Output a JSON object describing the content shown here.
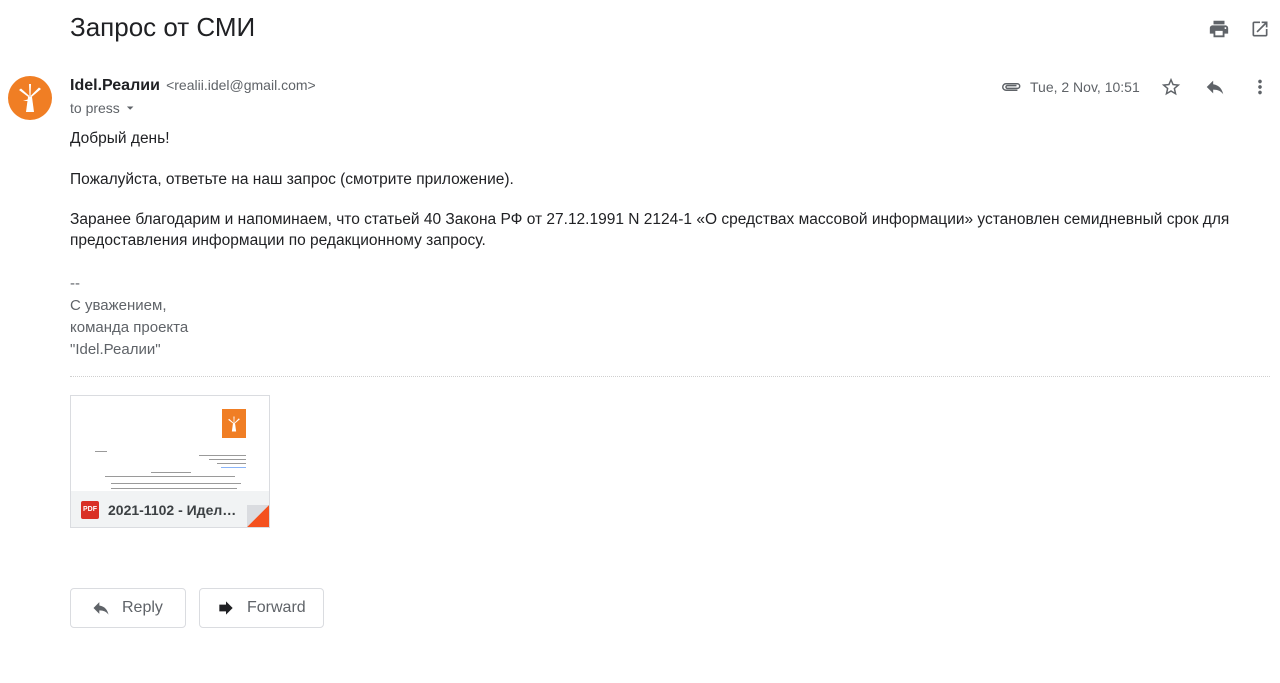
{
  "email": {
    "subject": "Запрос от СМИ",
    "sender_name": "Idel.Реалии",
    "sender_email": "<realii.idel@gmail.com>",
    "recipient": "to press",
    "date": "Tue, 2 Nov, 10:51",
    "greeting": "Добрый день!",
    "request": "Пожалуйста, ответьте на наш запрос (смотрите приложение).",
    "note": "Заранее благодарим и напоминаем, что статьей 40 Закона РФ от 27.12.1991 N 2124-1 «О средствах массовой информации» установлен семидневный срок для предоставления информации по редакционному запросу.",
    "signature": {
      "separator": "--",
      "closing": "С уважением,",
      "team": "команда проекта",
      "project": "\"Idel.Реалии\""
    }
  },
  "attachment": {
    "file_name": "2021-1102 - Идел…",
    "file_type": "PDF"
  },
  "actions": {
    "reply_label": "Reply",
    "forward_label": "Forward"
  },
  "icons": {
    "print": "print-icon",
    "open_in_new": "open-in-new-icon",
    "attachment": "paperclip-icon",
    "star": "star-icon",
    "reply": "reply-icon",
    "more": "more-vert-icon"
  },
  "colors": {
    "brand_orange": "#f07e24",
    "pdf_red": "#d93025"
  }
}
